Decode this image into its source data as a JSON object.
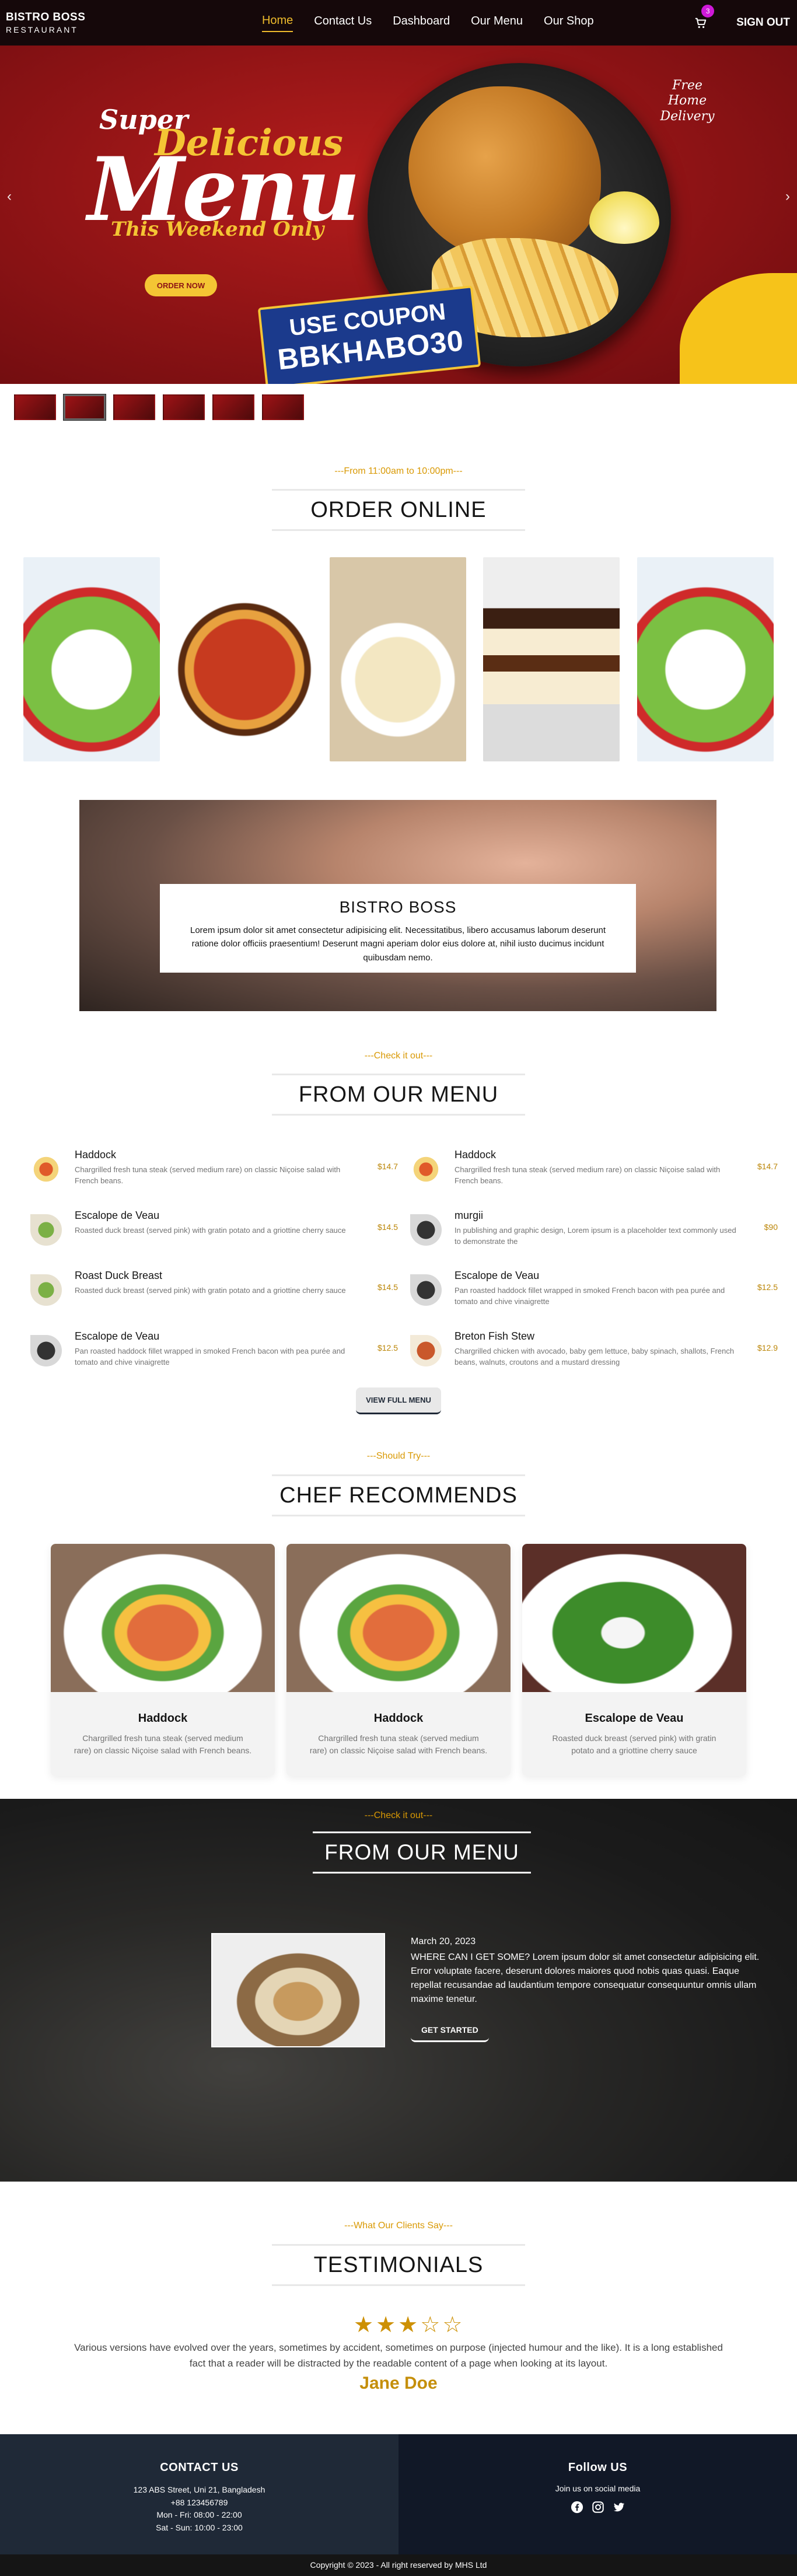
{
  "nav": {
    "brand_line1": "BISTRO BOSS",
    "brand_line2": "RESTAURANT",
    "links": [
      "Home",
      "Contact Us",
      "Dashboard",
      "Our Menu",
      "Our Shop"
    ],
    "active": "Home",
    "cart_count": "3",
    "signout": "SIGN OUT"
  },
  "hero": {
    "super": "Super",
    "delicious": "Delicious",
    "menu": "Menu",
    "weekend": "This Weekend Only",
    "order_btn": "ORDER NOW",
    "free_delivery": "Free Home Delivery",
    "coupon_line1": "USE COUPON",
    "coupon_code": "BBKHABO30",
    "thumb_count": 6,
    "selected_thumb": 1
  },
  "order_online": {
    "subtitle": "---From 11:00am to 10:00pm---",
    "title": "ORDER ONLINE"
  },
  "banner": {
    "title": "BISTRO BOSS",
    "text": "Lorem ipsum dolor sit amet consectetur adipisicing elit. Necessitatibus, libero accusamus laborum deserunt ratione dolor officiis praesentium! Deserunt magni aperiam dolor eius dolore at, nihil iusto ducimus incidunt quibusdam nemo."
  },
  "menu_section": {
    "subtitle": "---Check it out---",
    "title": "FROM OUR MENU",
    "items": [
      {
        "name": "Haddock",
        "desc": "Chargrilled fresh tuna steak (served medium rare) on classic Niçoise salad with French beans.",
        "price": "$14.7"
      },
      {
        "name": "Haddock",
        "desc": "Chargrilled fresh tuna steak (served medium rare) on classic Niçoise salad with French beans.",
        "price": "$14.7"
      },
      {
        "name": "Escalope de Veau",
        "desc": "Roasted duck breast (served pink) with gratin potato and a griottine cherry sauce",
        "price": "$14.5"
      },
      {
        "name": "murgii",
        "desc": "In publishing and graphic design, Lorem ipsum is a placeholder text commonly used to demonstrate the",
        "price": "$90"
      },
      {
        "name": "Roast Duck Breast",
        "desc": "Roasted duck breast (served pink) with gratin potato and a griottine cherry sauce",
        "price": "$14.5"
      },
      {
        "name": "Escalope de Veau",
        "desc": "Pan roasted haddock fillet wrapped in smoked French bacon with pea purée and tomato and chive vinaigrette",
        "price": "$12.5"
      },
      {
        "name": "Escalope de Veau",
        "desc": "Pan roasted haddock fillet wrapped in smoked French bacon with pea purée and tomato and chive vinaigrette",
        "price": "$12.5"
      },
      {
        "name": "Breton Fish Stew",
        "desc": "Chargrilled chicken with avocado, baby gem lettuce, baby spinach, shallots, French beans, walnuts, croutons and a mustard dressing",
        "price": "$12.9"
      }
    ],
    "view_btn": "VIEW FULL MENU"
  },
  "chef": {
    "subtitle": "---Should Try---",
    "title": "CHEF RECOMMENDS",
    "cards": [
      {
        "name": "Haddock",
        "desc": "Chargrilled fresh tuna steak (served medium rare) on classic Niçoise salad with French beans."
      },
      {
        "name": "Haddock",
        "desc": "Chargrilled fresh tuna steak (served medium rare) on classic Niçoise salad with French beans."
      },
      {
        "name": "Escalope de Veau",
        "desc": "Roasted duck breast (served pink) with gratin potato and a griottine cherry sauce"
      }
    ]
  },
  "featured": {
    "subtitle": "---Check it out---",
    "title": "FROM OUR MENU",
    "date": "March 20, 2023",
    "text": "WHERE CAN I GET SOME? Lorem ipsum dolor sit amet consectetur adipisicing elit. Error voluptate facere, deserunt dolores maiores quod nobis quas quasi. Eaque repellat recusandae ad laudantium tempore consequatur consequuntur omnis ullam maxime tenetur.",
    "button": "GET STARTED"
  },
  "testimonials": {
    "subtitle": "---What Our Clients Say---",
    "title": "TESTIMONIALS",
    "rating": 3,
    "rating_max": 5,
    "quote": "Various versions have evolved over the years, sometimes by accident, sometimes on purpose (injected humour and the like). It is a long established fact that a reader will be distracted by the readable content of a page when looking at its layout.",
    "name": "Jane Doe"
  },
  "footer": {
    "contact_title": "CONTACT US",
    "address": "123 ABS Street, Uni 21, Bangladesh",
    "phone": "+88 123456789",
    "hours_weekday": "Mon - Fri: 08:00 - 22:00",
    "hours_weekend": "Sat - Sun: 10:00 - 23:00",
    "follow_title": "Follow US",
    "follow_text": "Join us on social media",
    "copyright": "Copyright © 2023 - All right reserved by MHS Ltd"
  },
  "colors": {
    "accent": "#d99904",
    "nav_bg": "#15080a",
    "footer_left": "#1f2937",
    "footer_right": "#111827"
  },
  "icons": [
    "cart-icon",
    "chevron-left-icon",
    "chevron-right-icon",
    "facebook-icon",
    "instagram-icon",
    "twitter-icon",
    "star-icon"
  ]
}
